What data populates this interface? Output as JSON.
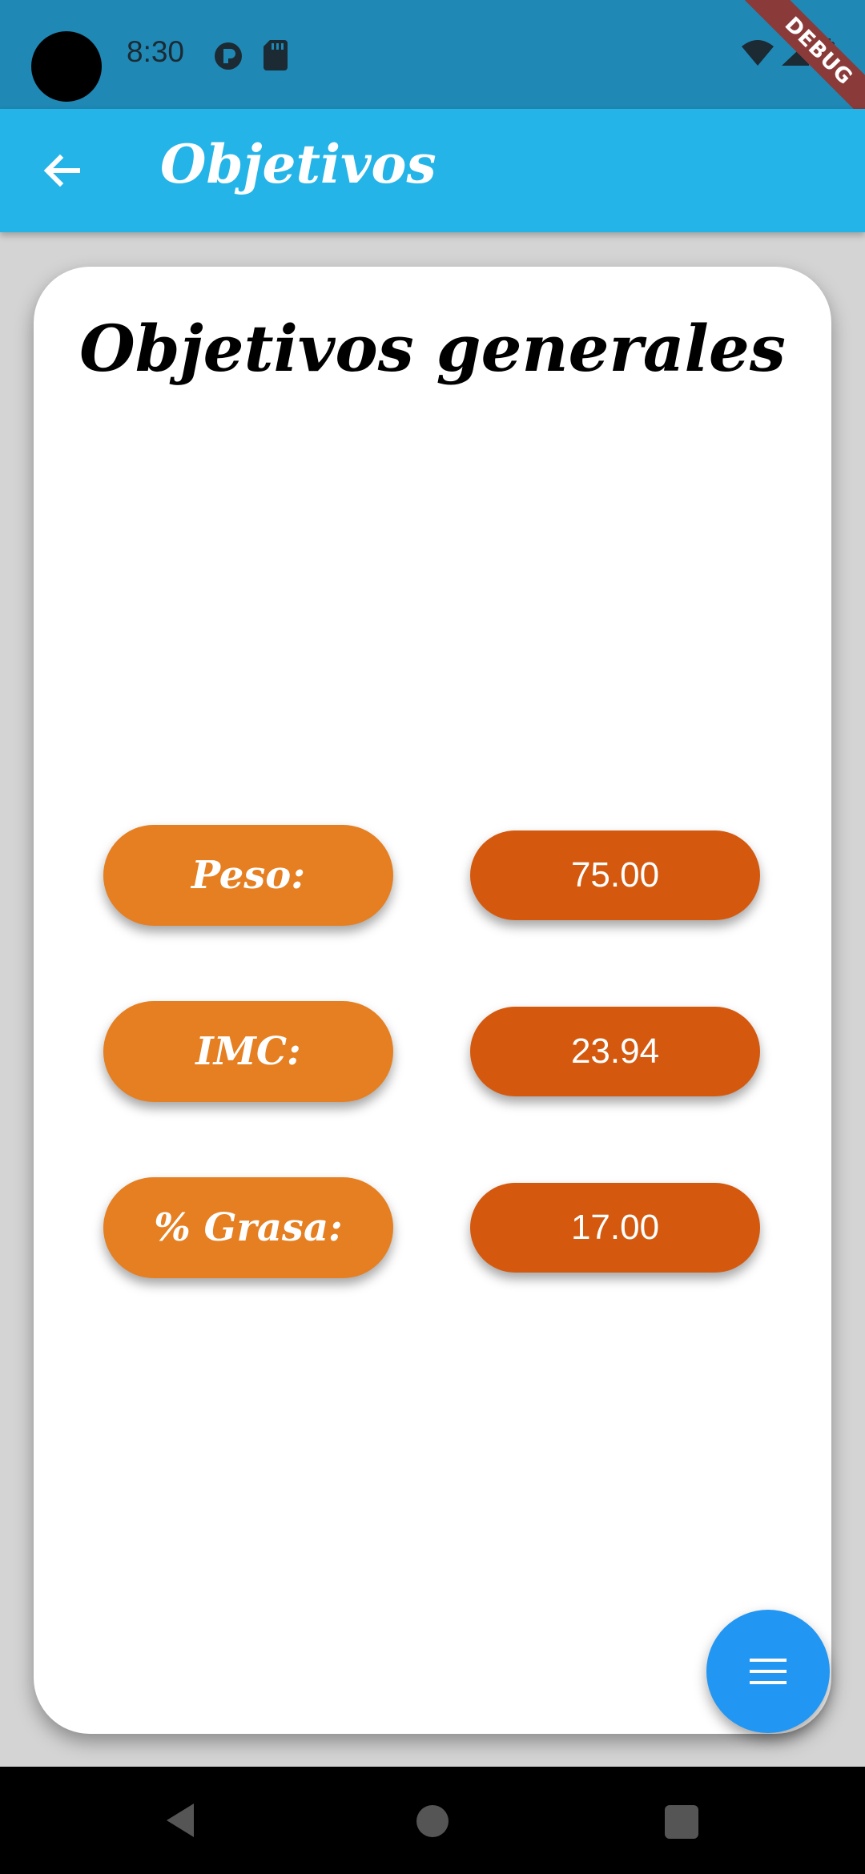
{
  "status_bar": {
    "time": "8:30",
    "icons": [
      "camera-cutout",
      "p-circle-icon",
      "sd-card-icon",
      "wifi-icon",
      "signal-icon",
      "battery-icon"
    ]
  },
  "debug_banner": {
    "label": "DEBUG"
  },
  "app_bar": {
    "title": "Objetivos",
    "back_icon": "arrow-back-icon"
  },
  "card": {
    "title": "Objetivos generales",
    "rows": [
      {
        "label": "Peso:",
        "value": "75.00"
      },
      {
        "label": "IMC:",
        "value": "23.94"
      },
      {
        "label": "% Grasa:",
        "value": "17.00"
      }
    ]
  },
  "fab": {
    "icon": "menu-icon"
  },
  "colors": {
    "status_bar": "#1f88b5",
    "app_bar": "#24b4e8",
    "label_pill": "#e57f21",
    "value_pill": "#d4590f",
    "fab": "#2196f3",
    "background": "#d4d4d4"
  }
}
